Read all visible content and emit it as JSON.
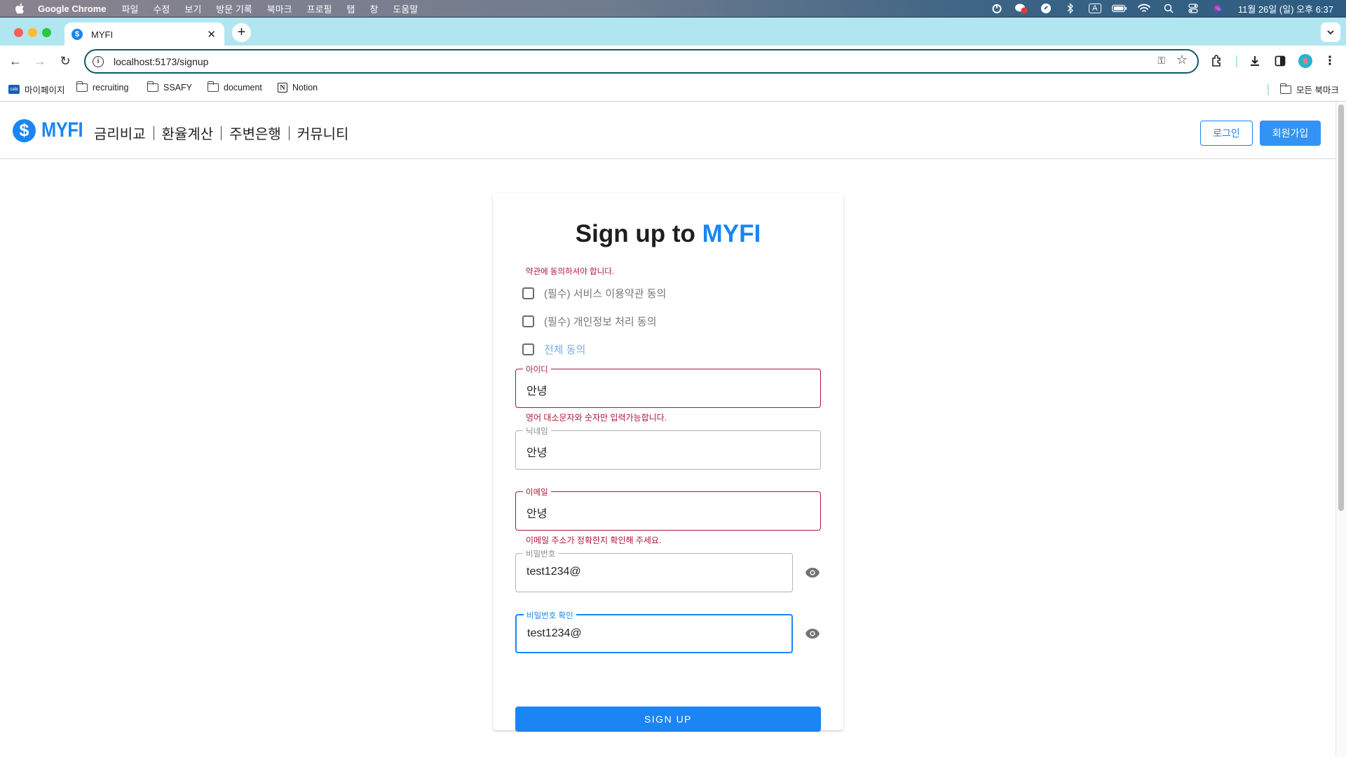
{
  "menubar": {
    "app_name": "Google Chrome",
    "items": [
      "파일",
      "수정",
      "보기",
      "방문 기록",
      "북마크",
      "프로필",
      "탭",
      "창",
      "도움말"
    ],
    "status_icons": [
      "power-icon",
      "messenger-icon",
      "vpn-icon",
      "bluetooth-icon",
      "input-source-icon",
      "battery-icon",
      "wifi-icon",
      "spotlight-icon",
      "control-center-icon",
      "siri-icon"
    ],
    "input_source": "A",
    "clock": "11월 26일 (일) 오후 6:37"
  },
  "browser": {
    "tab_title": "MYFI",
    "tab_favicon": "$",
    "url": "localhost:5173/signup",
    "bookmarks": [
      {
        "label": "마이페이지",
        "icon": "site-icon"
      },
      {
        "label": "recruiting",
        "icon": "folder-icon"
      },
      {
        "label": "SSAFY",
        "icon": "folder-icon"
      },
      {
        "label": "document",
        "icon": "folder-icon"
      },
      {
        "label": "Notion",
        "icon": "notion-icon"
      }
    ],
    "all_bookmarks": "모든 북마크"
  },
  "header": {
    "logo_symbol": "$",
    "logo_text": "MYFI",
    "nav": [
      "금리비교",
      "환율계산",
      "주변은행",
      "커뮤니티"
    ],
    "login": "로그인",
    "signup": "회원가입"
  },
  "form": {
    "title_prefix": "Sign up to ",
    "title_brand": "MYFI",
    "terms_error": "약관에 동의하셔야 합니다.",
    "checkboxes": [
      {
        "label": "(필수) 서비스 이용약관 동의",
        "checked": false
      },
      {
        "label": "(필수) 개인정보 처리 동의",
        "checked": false
      },
      {
        "label": "전체 동의",
        "checked": false
      }
    ],
    "fields": {
      "id": {
        "label": "아이디",
        "value": "안녕",
        "error": "영어 대소문자와 숫자만 입력가능합니다."
      },
      "nickname": {
        "label": "닉네임",
        "value": "안녕"
      },
      "email": {
        "label": "이메일",
        "value": "안녕",
        "error": "이메일 주소가 정확한지 확인해 주세요."
      },
      "password": {
        "label": "비밀번호",
        "value": "test1234@"
      },
      "password_confirm": {
        "label": "비밀번호 확인",
        "value": "test1234@"
      }
    },
    "submit": "SIGN UP"
  },
  "colors": {
    "brand": "#1a85f3",
    "error": "#b0163a",
    "tabstrip": "#b1e6f0"
  }
}
